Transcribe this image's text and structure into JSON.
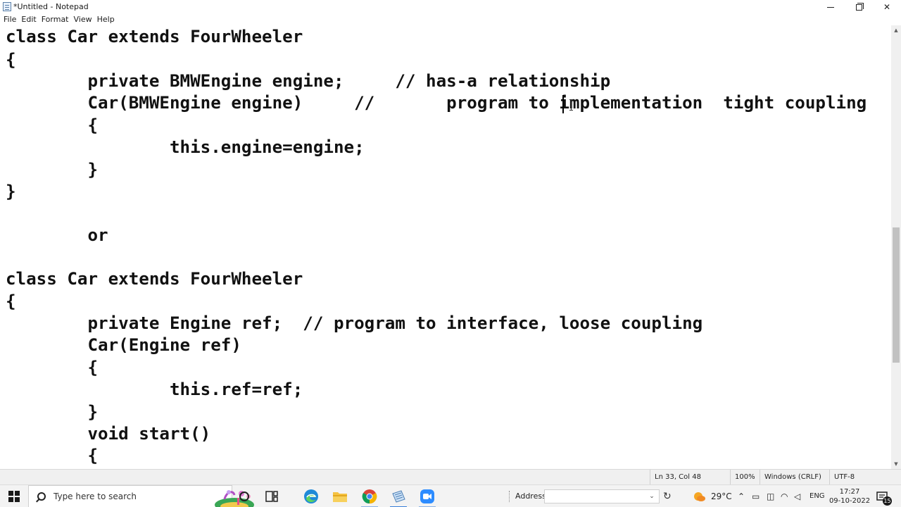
{
  "window": {
    "title": "*Untitled - Notepad",
    "minimize_glyph": "minimize-icon",
    "maximize_glyph": "maximize-icon",
    "close_glyph": "✕"
  },
  "menu": [
    "File",
    "Edit",
    "Format",
    "View",
    "Help"
  ],
  "editor": {
    "lines": [
      "class Car extends FourWheeler",
      "{",
      "        private BMWEngine engine;     // has-a relationship",
      "        Car(BMWEngine engine)     //       program to implementation  tight coupling",
      "        {",
      "                this.engine=engine;",
      "        }",
      "}",
      "",
      "        or",
      "",
      "class Car extends FourWheeler",
      "{",
      "        private Engine ref;  // program to interface, loose coupling",
      "        Car(Engine ref)",
      "        {",
      "                this.ref=ref;",
      "        }",
      "        void start()",
      "        {"
    ]
  },
  "statusbar": {
    "position": "Ln 33, Col 48",
    "zoom": "100%",
    "line_endings": "Windows (CRLF)",
    "encoding": "UTF-8"
  },
  "taskbar": {
    "search_placeholder": "Type here to search",
    "address_label": "Address",
    "address_value": "",
    "temperature": "29°C",
    "language": "ENG",
    "time": "17:27",
    "date": "09-10-2022",
    "notification_count": "15",
    "icons": [
      "start-icon",
      "search-icon",
      "cortana-icon",
      "task-view-icon",
      "edge-icon",
      "file-explorer-icon",
      "chrome-icon",
      "notepad-icon",
      "zoom-icon",
      "weather-icon",
      "chevron-up-icon",
      "battery-icon",
      "network-icon",
      "wifi-icon",
      "volume-icon",
      "notification-icon"
    ]
  },
  "colors": {
    "accent": "#3a80d9",
    "text": "#111111",
    "statusbar_bg": "#f0f0f0"
  }
}
